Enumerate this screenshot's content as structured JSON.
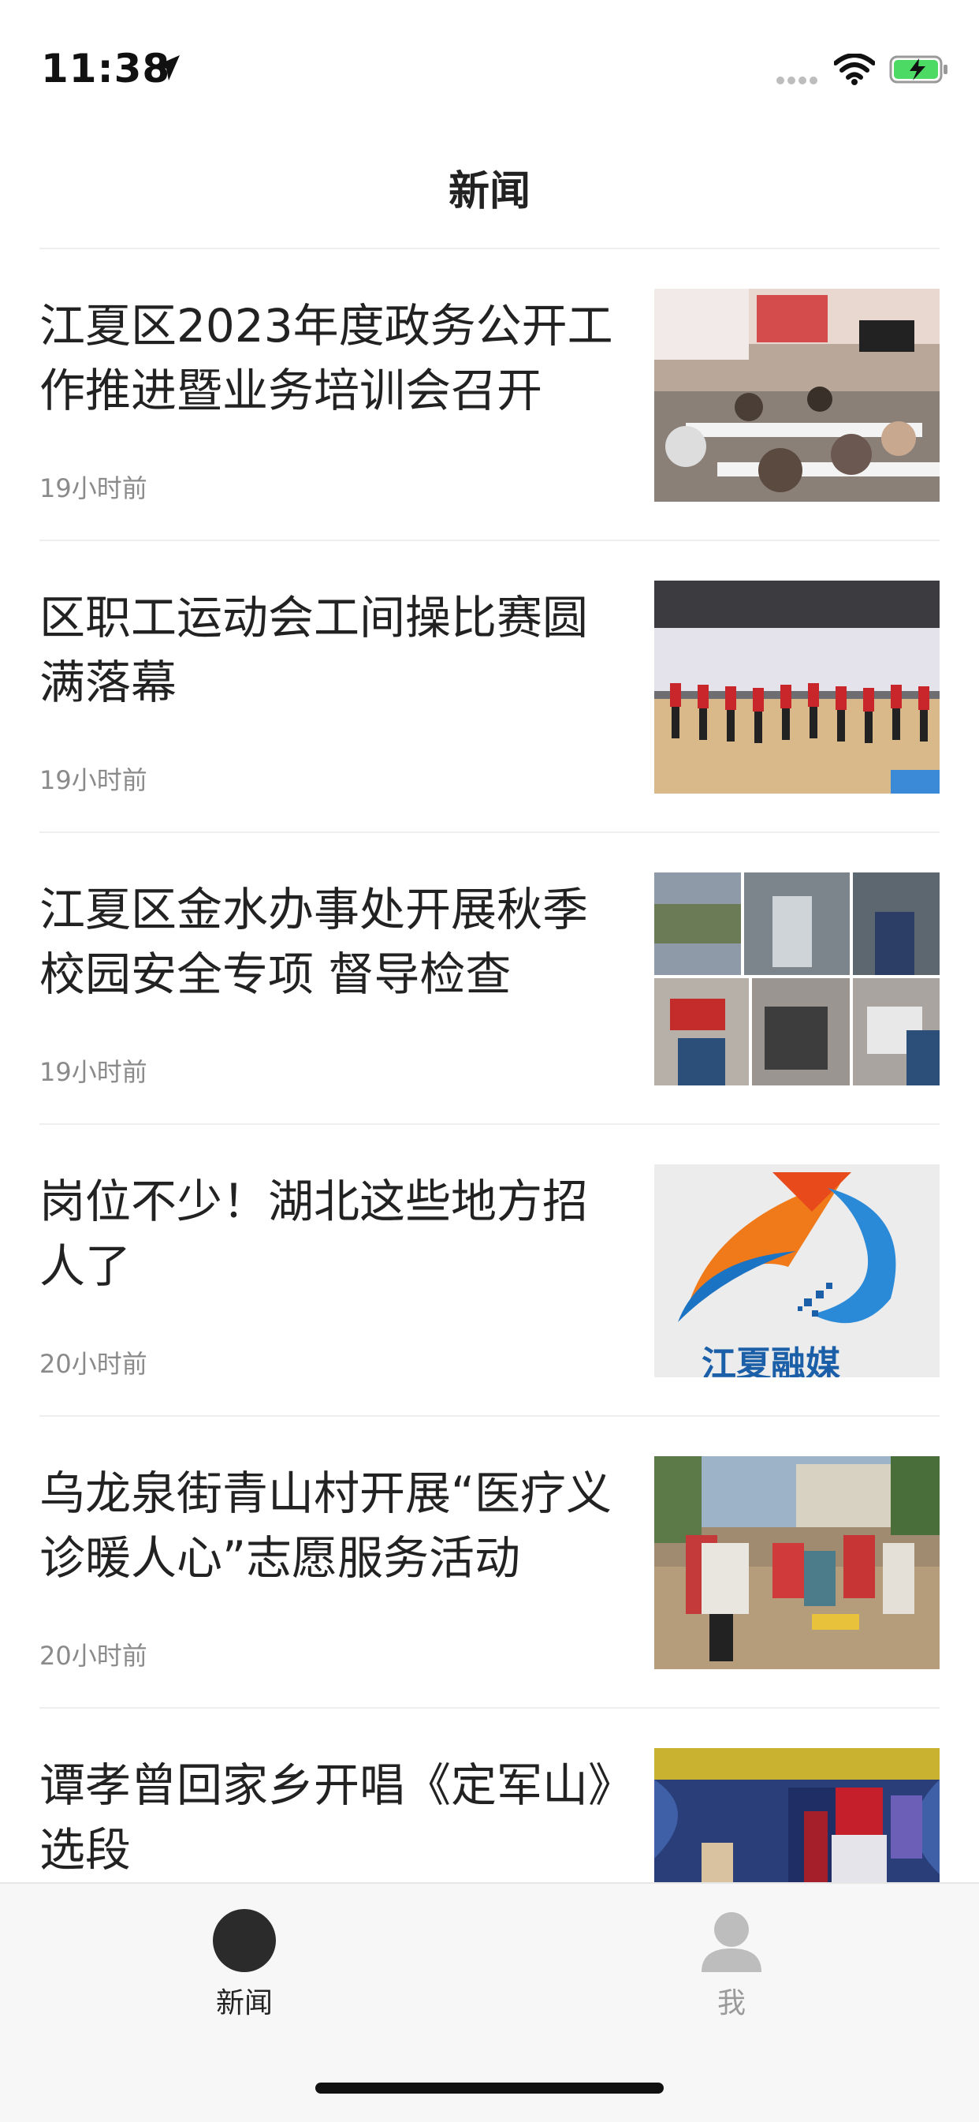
{
  "status_bar": {
    "time": "11:38",
    "icons": [
      "location-arrow-icon",
      "signal-icon",
      "wifi-icon",
      "battery-charging-icon"
    ]
  },
  "nav": {
    "title": "新闻"
  },
  "news": [
    {
      "title": "江夏区2023年度政务公开工作推进暨业务培训会召开",
      "time": "19小时前",
      "thumb": "photo-training-meeting"
    },
    {
      "title": "区职工运动会工间操比赛圆满落幕",
      "time": "19小时前",
      "thumb": "photo-gym-exercise"
    },
    {
      "title": "江夏区金水办事处开展秋季校园安全专项 督导检查",
      "time": "19小时前",
      "thumb": "photo-collage-inspection"
    },
    {
      "title": "岗位不少！湖北这些地方招人了",
      "time": "20小时前",
      "thumb": "logo-jiangxia-media",
      "thumb_text": "江夏融媒"
    },
    {
      "title": "乌龙泉街青山村开展“医疗义诊暖人心”志愿服务活动",
      "time": "20小时前",
      "thumb": "photo-volunteer-clinic"
    },
    {
      "title": "谭孝曾回家乡开唱《定军山》选段",
      "time": "",
      "thumb": "photo-opera-stage"
    }
  ],
  "tab_bar": {
    "tabs": [
      {
        "label": "新闻",
        "icon": "news-circle-icon",
        "active": true
      },
      {
        "label": "我",
        "icon": "user-icon",
        "active": false
      }
    ]
  }
}
